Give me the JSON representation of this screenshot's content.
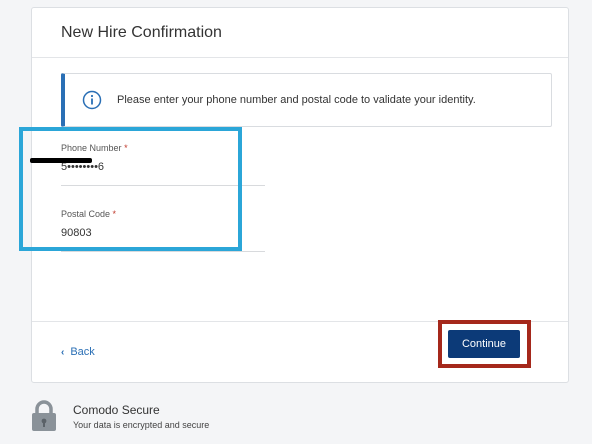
{
  "card": {
    "title": "New Hire Confirmation"
  },
  "info": {
    "icon": "info-icon",
    "message": "Please enter your phone number and postal code to validate your identity."
  },
  "fields": {
    "phone": {
      "label": "Phone Number",
      "required_mark": "*",
      "value": "5••••••••6"
    },
    "postal": {
      "label": "Postal Code",
      "required_mark": "*",
      "value": "90803"
    }
  },
  "footer": {
    "back_label": "Back",
    "back_icon": "chevron-left-icon",
    "continue_label": "Continue"
  },
  "secure": {
    "icon": "lock-icon",
    "title": "Comodo Secure",
    "subtitle": "Your data is encrypted and secure"
  },
  "colors": {
    "accent": "#2a6fb5",
    "button": "#0c3a78",
    "highlight_blue": "#2ba6d8",
    "highlight_red": "#a5281b",
    "required": "#c0392b"
  }
}
